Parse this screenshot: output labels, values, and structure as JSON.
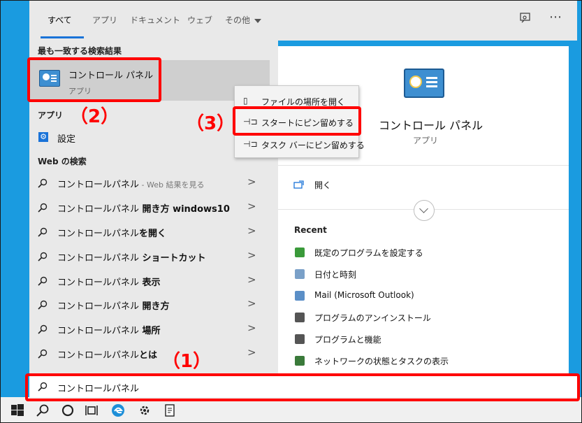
{
  "tabs": [
    {
      "label": "すべて",
      "active": true
    },
    {
      "label": "アプリ",
      "active": false
    },
    {
      "label": "ドキュメント",
      "active": false
    },
    {
      "label": "ウェブ",
      "active": false
    },
    {
      "label": "その他",
      "active": false
    }
  ],
  "toolbar": {
    "feedback_icon": "feedback-icon",
    "more_icon": "more-icon",
    "more_glyph": "⋯"
  },
  "left": {
    "best_match_title": "最も一致する検索結果",
    "best_match": {
      "name": "コントロール パネル",
      "type": "アプリ"
    },
    "apps_title": "アプリ",
    "apps": [
      {
        "name": "設定"
      }
    ],
    "web_title": "Web の検索",
    "web_results": [
      {
        "prefix": "コントロールパネル",
        "suffix": " - Web 結果を見る",
        "bold": ""
      },
      {
        "prefix": "コントロールパネル",
        "suffix": "",
        "bold": " 開き方 windows10"
      },
      {
        "prefix": "コントロールパネル",
        "suffix": "",
        "bold": "を開く"
      },
      {
        "prefix": "コントロールパネル",
        "suffix": "",
        "bold": " ショートカット"
      },
      {
        "prefix": "コントロールパネル",
        "suffix": "",
        "bold": " 表示"
      },
      {
        "prefix": "コントロールパネル",
        "suffix": "",
        "bold": " 開き方"
      },
      {
        "prefix": "コントロールパネル",
        "suffix": "",
        "bold": " 場所"
      },
      {
        "prefix": "コントロールパネル",
        "suffix": "",
        "bold": "とは"
      }
    ]
  },
  "context_menu": [
    {
      "label": "ファイルの場所を開く",
      "icon": "file-location-icon",
      "glyph": "▯"
    },
    {
      "label": "スタートにピン留めする",
      "icon": "pin-icon",
      "glyph": "⊣⊐"
    },
    {
      "label": "タスク バーにピン留めする",
      "icon": "pin-icon",
      "glyph": "⊣⊐"
    }
  ],
  "preview": {
    "title": "コントロール パネル",
    "type": "アプリ",
    "open_label": "開く",
    "recent_title": "Recent",
    "recent": [
      {
        "label": "既定のプログラムを設定する",
        "icon": "default-programs-icon",
        "color": "#3a9a3a"
      },
      {
        "label": "日付と時刻",
        "icon": "clock-icon",
        "color": "#7aa0c8"
      },
      {
        "label": "Mail (Microsoft Outlook)",
        "icon": "mail-icon",
        "color": "#5b8fc7"
      },
      {
        "label": "プログラムのアンインストール",
        "icon": "programs-icon",
        "color": "#555555"
      },
      {
        "label": "プログラムと機能",
        "icon": "programs-icon",
        "color": "#555555"
      },
      {
        "label": "ネットワークの状態とタスクの表示",
        "icon": "network-icon",
        "color": "#3a7a3a"
      }
    ]
  },
  "search": {
    "value": "コントロールパネル"
  },
  "annotations": {
    "one": "（1）",
    "two": "（2）",
    "three": "（3）"
  },
  "colors": {
    "accent": "#1a73d8",
    "highlight": "#ff0000",
    "desktop": "#1a9be0"
  },
  "taskbar_icons": [
    "windows-start-icon",
    "search-icon",
    "cortana-icon",
    "task-view-icon",
    "edge-icon",
    "settings-icon",
    "notepad-icon"
  ]
}
